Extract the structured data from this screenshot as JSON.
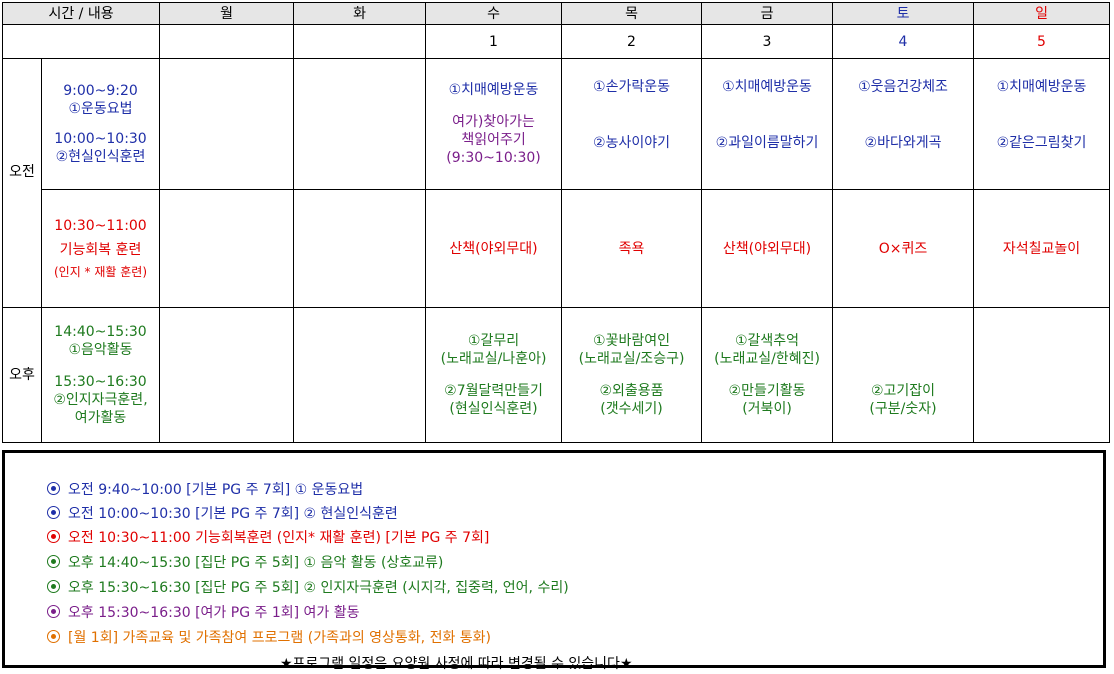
{
  "header": {
    "time_content": "시간 / 내용",
    "days": [
      "월",
      "화",
      "수",
      "목",
      "금",
      "토",
      "일"
    ],
    "dates": [
      "",
      "",
      "1",
      "2",
      "3",
      "4",
      "5"
    ]
  },
  "periods": {
    "am": "오전",
    "pm": "오후"
  },
  "row1": {
    "time": [
      "9:00~9:20",
      "①운동요법",
      "10:00~10:30",
      "②현실인식훈련"
    ],
    "wed": [
      "①치매예방운동",
      "여가)찾아가는",
      "책읽어주기",
      "(9:30~10:30)"
    ],
    "thu": [
      "①손가락운동",
      "②농사이야기"
    ],
    "fri": [
      "①치매예방운동",
      "②과일이름말하기"
    ],
    "sat": [
      "①웃음건강체조",
      "②바다와게곡"
    ],
    "sun": [
      "①치매예방운동",
      "②같은그림찾기"
    ]
  },
  "row2": {
    "time": [
      "10:30~11:00",
      "기능회복 훈련",
      "(인지 * 재활 훈련)"
    ],
    "wed": "산책(야외무대)",
    "thu": "족욕",
    "fri": "산책(야외무대)",
    "sat": "O×퀴즈",
    "sun": "자석칠교놀이"
  },
  "row3": {
    "time": [
      "14:40~15:30",
      "①음악활동",
      "15:30~16:30",
      "②인지자극훈련,",
      "여가활동"
    ],
    "wed": [
      "①갈무리",
      "(노래교실/나훈아)",
      "②7월달력만들기",
      "(현실인식훈련)"
    ],
    "thu": [
      "①꽃바람여인",
      "(노래교실/조승구)",
      "②외출용품",
      "(갯수세기)"
    ],
    "fri": [
      "①갈색추억",
      "(노래교실/한혜진)",
      "②만들기활동",
      "(거북이)"
    ],
    "sat": [
      "②고기잡이",
      "(구분/숫자)"
    ]
  },
  "legend": {
    "items": [
      {
        "text": "오전 9:40~10:00 [기본 PG 주 7회] ① 운동요법",
        "color": "#1f2fa8"
      },
      {
        "text": "오전 10:00~10:30 [기본 PG 주 7회] ② 현실인식훈련",
        "color": "#1f2fa8"
      },
      {
        "text": "오전 10:30~11:00 기능회복훈련 (인지* 재활 훈련) [기본 PG 주 7회]",
        "color": "#e00000"
      },
      {
        "text": "오후 14:40~15:30 [집단 PG 주 5회] ① 음악 활동 (상호교류)",
        "color": "#1e7a1e"
      },
      {
        "text": "오후 15:30~16:30 [집단 PG 주 5회] ② 인지자극훈련 (시지각, 집중력, 언어, 수리)",
        "color": "#1e7a1e"
      },
      {
        "text": "오후 15:30~16:30 [여가 PG 주 1회]  여가 활동",
        "color": "#7a1e8a"
      },
      {
        "text": "[월 1회] 가족교육 및 가족참여 프로그램 (가족과의 영상통화, 전화 통화)",
        "color": "#e07000"
      }
    ],
    "note": "★프로그램 일정은 요양원 사정에 따라 변경될 수 있습니다★"
  },
  "colors": {
    "sat_date": "#1f2fa8",
    "sun_date": "#e00000"
  }
}
